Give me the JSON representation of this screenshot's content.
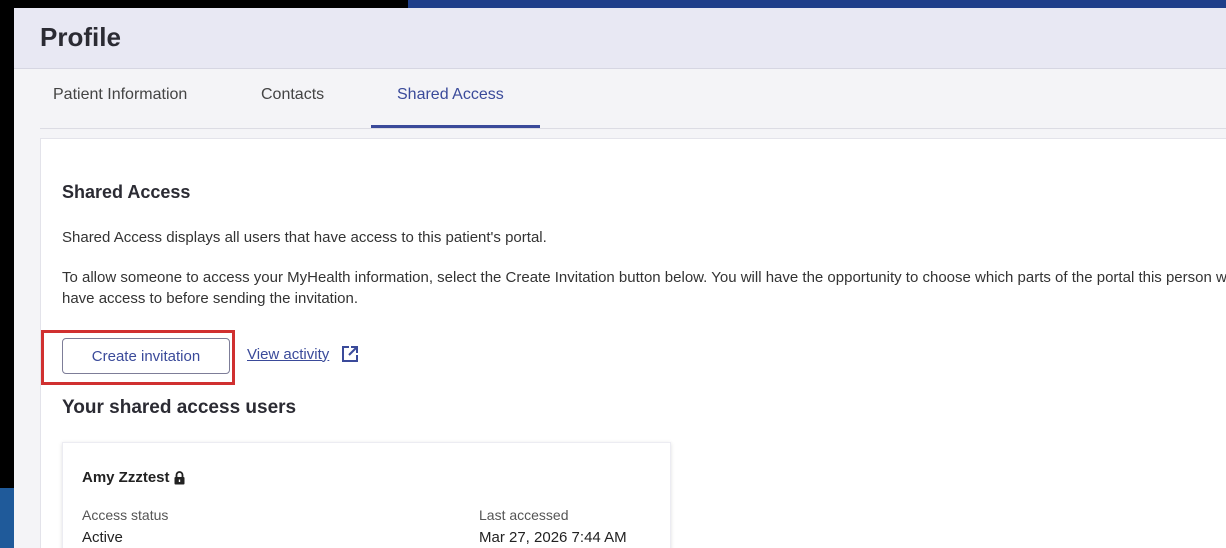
{
  "header": {
    "title": "Profile"
  },
  "tabs": [
    {
      "label": "Patient Information",
      "active": false
    },
    {
      "label": "Contacts",
      "active": false
    },
    {
      "label": "Shared Access",
      "active": true
    }
  ],
  "shared_access": {
    "title": "Shared Access",
    "description": "Shared Access displays all users that have access to this patient's portal.",
    "instructions": "To allow someone to access your MyHealth information, select the Create Invitation button below. You will have the opportunity to choose which parts of the portal this person will have access to before sending the invitation.",
    "create_button_label": "Create invitation",
    "view_activity_label": "View activity",
    "users_heading": "Your shared access users"
  },
  "users": [
    {
      "name": "Amy Zzztest",
      "locked": true,
      "access_status_label": "Access status",
      "access_status": "Active",
      "last_accessed_label": "Last accessed",
      "last_accessed": "Mar 27, 2026 7:44 AM"
    }
  ],
  "colors": {
    "accent": "#3a4a9a",
    "highlight": "#d03030",
    "header_bg": "#e8e8f3"
  },
  "icons": {
    "external_link": "external-link-icon",
    "lock": "lock-icon"
  }
}
